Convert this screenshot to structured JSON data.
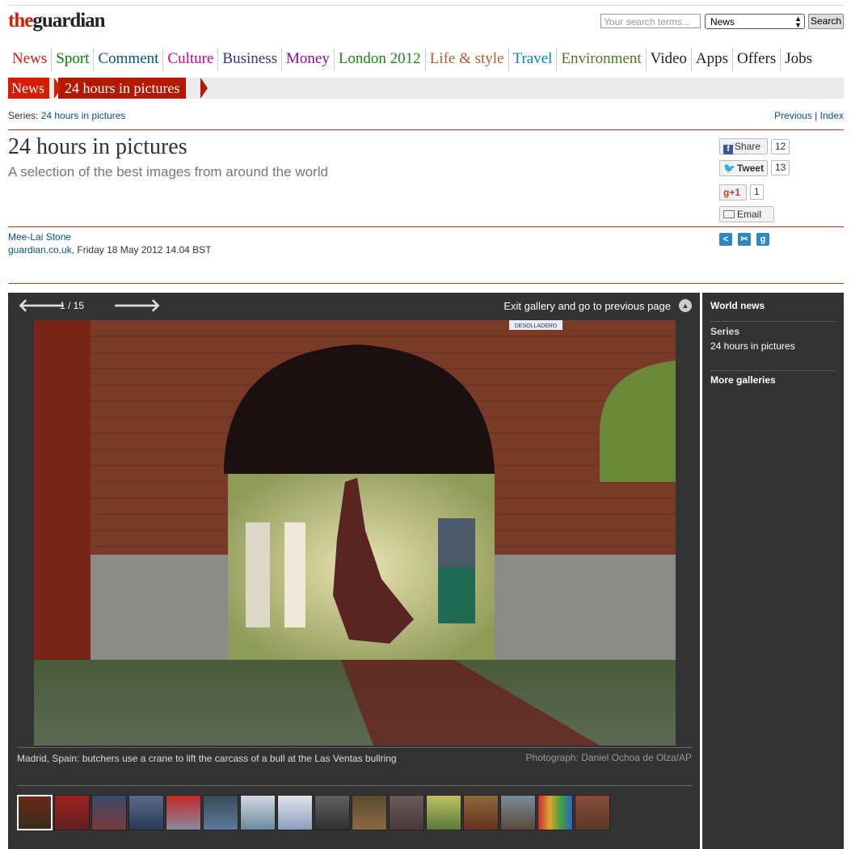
{
  "header": {
    "logo_the": "the",
    "logo_rest": "guardian",
    "search_placeholder": "Your search terms...",
    "search_scope": "News",
    "search_button": "Search"
  },
  "nav": [
    {
      "label": "News",
      "color": "#d61d00"
    },
    {
      "label": "Sport",
      "color": "#008000"
    },
    {
      "label": "Comment",
      "color": "#005689"
    },
    {
      "label": "Culture",
      "color": "#d1008b"
    },
    {
      "label": "Business",
      "color": "#2e3192"
    },
    {
      "label": "Money",
      "color": "#8b0a9c"
    },
    {
      "label": "London 2012",
      "color": "#198a0f"
    },
    {
      "label": "Life & style",
      "color": "#b85c2e"
    },
    {
      "label": "Travel",
      "color": "#0083c1"
    },
    {
      "label": "Environment",
      "color": "#4a7a1b"
    },
    {
      "label": "Video",
      "color": "#222222"
    },
    {
      "label": "Apps",
      "color": "#222222"
    },
    {
      "label": "Offers",
      "color": "#222222"
    },
    {
      "label": "Jobs",
      "color": "#222222"
    }
  ],
  "breadcrumb": {
    "section": "News",
    "series": "24 hours in pictures"
  },
  "series_line": {
    "prefix": "Series:",
    "link": "24 hours in pictures",
    "previous": "Previous",
    "sep": "|",
    "index": "Index"
  },
  "article": {
    "headline": "24 hours in pictures",
    "standfirst": "A selection of the best images from around the world",
    "author": "Mee-Lai Stone",
    "site": "guardian.co.uk",
    "date": ", Friday 18 May 2012 14.04 BST"
  },
  "social": {
    "share_label": "Share",
    "share_count": "12",
    "tweet_label": "Tweet",
    "tweet_count": "13",
    "plusone_label": "+1",
    "plusone_count": "1",
    "email_label": "Email"
  },
  "gallery": {
    "counter": "1 / 15",
    "exit_label": "Exit gallery and go to previous page",
    "caption": "Madrid, Spain: butchers use a crane to lift the carcass of a bull at the Las Ventas bullring",
    "credit": "Photograph: Daniel Ochoa de Olza/AP",
    "sign_text": "DESOLLADERO",
    "thumbnail_count": 15
  },
  "sidebar": {
    "section": "World news",
    "series_label": "Series",
    "series_value": "24 hours in pictures",
    "more": "More galleries"
  }
}
